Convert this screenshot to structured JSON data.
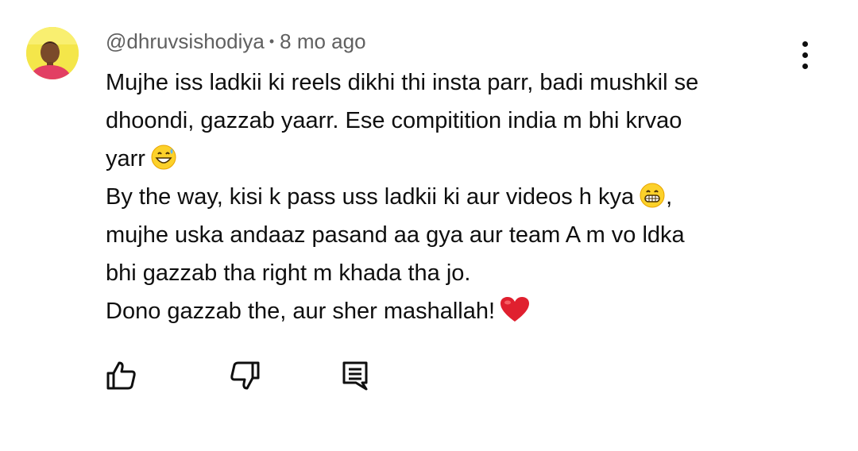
{
  "comment": {
    "username": "@dhruvsishodiya",
    "separator": "•",
    "timestamp": "8 mo ago",
    "lines": [
      {
        "text": "Mujhe iss ladkii ki reels dikhi thi insta parr, badi mushkil se",
        "emoji": ""
      },
      {
        "text": "dhoondi, gazzab  yaarr. Ese compitition india m bhi krvao",
        "emoji": ""
      },
      {
        "text": "yarr",
        "emoji": "grin-sweat-emoji"
      },
      {
        "text": "By the way, kisi k pass uss ladkii ki aur videos h kya",
        "emoji": "grimace-emoji",
        "suffix": ","
      },
      {
        "text": "mujhe uska andaaz pasand aa gya aur team A m vo ldka",
        "emoji": ""
      },
      {
        "text": "bhi gazzab tha right m khada tha jo.",
        "emoji": ""
      },
      {
        "text": "Dono gazzab the, aur sher mashallah!",
        "emoji": "red-heart-emoji"
      }
    ]
  },
  "actions": {
    "like_icon": "thumbs-up-icon",
    "dislike_icon": "thumbs-down-icon",
    "reply_icon": "reply-comment-icon",
    "menu_icon": "more-vert-icon"
  },
  "colors": {
    "text": "#0f0f0f",
    "meta": "#606060",
    "avatar_bg": "#f4e64a",
    "shirt": "#e23f63",
    "heart": "#e0202f"
  }
}
